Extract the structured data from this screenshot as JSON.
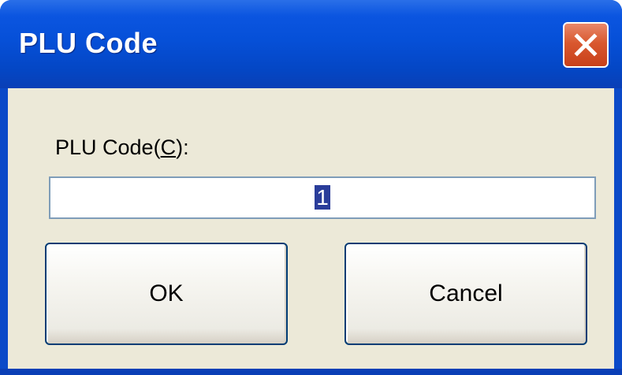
{
  "window": {
    "title": "PLU Code",
    "close_icon": "close-x-icon"
  },
  "form": {
    "label_prefix": "PLU Code(",
    "label_accel": "C",
    "label_suffix": "):",
    "input_value": "1"
  },
  "buttons": {
    "ok_label": "OK",
    "cancel_label": "Cancel"
  },
  "colors": {
    "titlebar": "#0650d8",
    "client_bg": "#ece9d8",
    "close_button": "#d9582f",
    "input_border": "#7f9db9",
    "button_border": "#003c74",
    "selection": "#2a3d9a"
  }
}
